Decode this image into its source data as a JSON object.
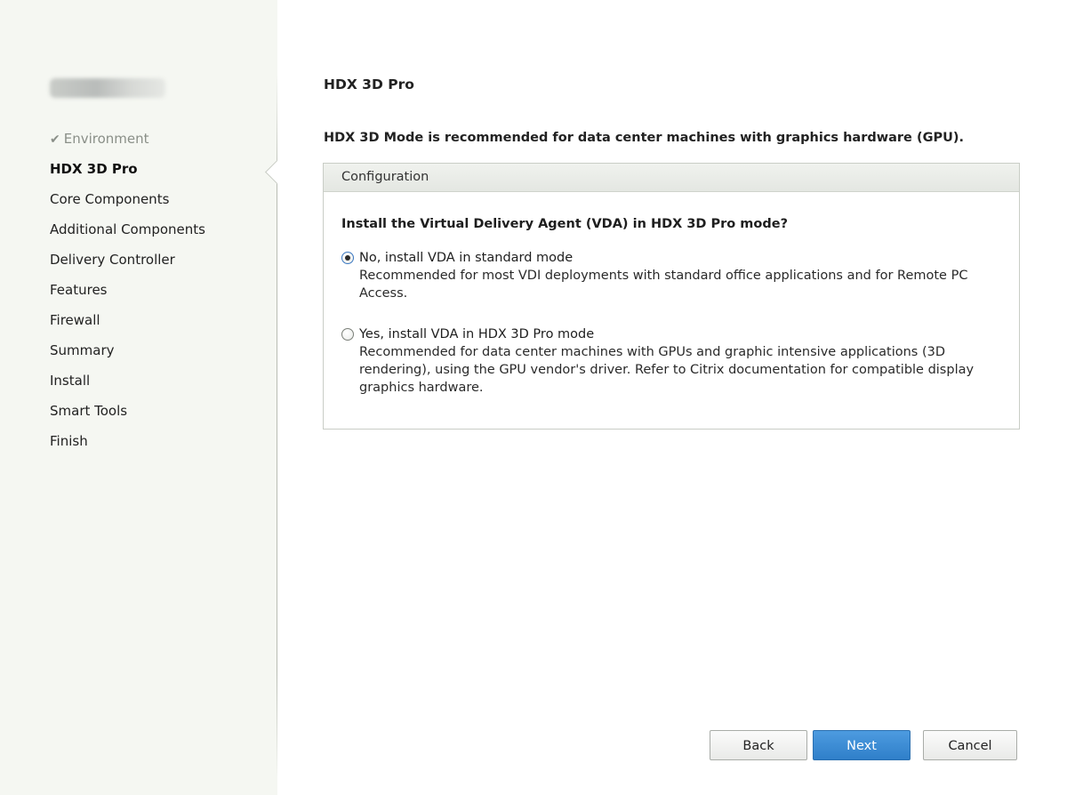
{
  "sidebar": {
    "steps": [
      {
        "label": "Environment",
        "state": "done"
      },
      {
        "label": "HDX 3D Pro",
        "state": "current"
      },
      {
        "label": "Core Components",
        "state": "pending"
      },
      {
        "label": "Additional Components",
        "state": "pending"
      },
      {
        "label": "Delivery Controller",
        "state": "pending"
      },
      {
        "label": "Features",
        "state": "pending"
      },
      {
        "label": "Firewall",
        "state": "pending"
      },
      {
        "label": "Summary",
        "state": "pending"
      },
      {
        "label": "Install",
        "state": "pending"
      },
      {
        "label": "Smart Tools",
        "state": "pending"
      },
      {
        "label": "Finish",
        "state": "pending"
      }
    ]
  },
  "main": {
    "title": "HDX 3D Pro",
    "description": "HDX 3D Mode is recommended for data center machines with graphics hardware (GPU).",
    "config": {
      "header": "Configuration",
      "question": "Install the Virtual Delivery Agent (VDA) in HDX 3D Pro mode?",
      "options": [
        {
          "label": "No, install VDA in standard mode",
          "description": "Recommended for most VDI deployments with standard office applications and for Remote PC Access.",
          "selected": true
        },
        {
          "label": "Yes, install VDA in HDX 3D Pro mode",
          "description": "Recommended for data center machines with GPUs and graphic intensive applications (3D rendering), using the GPU vendor's driver. Refer to Citrix documentation for compatible display graphics hardware.",
          "selected": false
        }
      ]
    }
  },
  "buttons": {
    "back": "Back",
    "next": "Next",
    "cancel": "Cancel"
  },
  "colors": {
    "accent": "#2f7fc9",
    "done_step": "#8a8f88"
  }
}
